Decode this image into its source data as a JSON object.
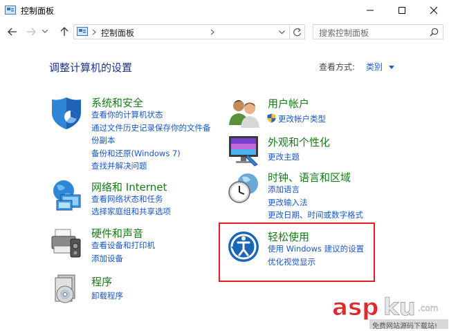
{
  "window": {
    "title": "控制面板",
    "minimize_icon": "minimize-icon",
    "maximize_icon": "maximize-icon",
    "close_icon": "close-icon"
  },
  "nav": {
    "address_path": "控制面板",
    "search_placeholder": "搜索控制面板"
  },
  "main": {
    "heading": "调整计算机的设置",
    "view_by_label": "查看方式:",
    "view_by_value": "类别"
  },
  "categories": {
    "system_security": {
      "title": "系统和安全",
      "links": [
        "查看你的计算机状态",
        "通过文件历史记录保存你的文件备",
        "份副本",
        "备份和还原(Windows 7)",
        "查找并解决问题"
      ]
    },
    "network": {
      "title": "网络和 Internet",
      "links": [
        "查看网络状态和任务",
        "选择家庭组和共享选项"
      ]
    },
    "hardware": {
      "title": "硬件和声音",
      "links": [
        "查看设备和打印机",
        "添加设备"
      ]
    },
    "programs": {
      "title": "程序",
      "links": [
        "卸载程序"
      ]
    },
    "user_accounts": {
      "title": "用户帐户",
      "links": [
        "更改帐户类型"
      ]
    },
    "appearance": {
      "title": "外观和个性化",
      "links": [
        "更改主题"
      ]
    },
    "clock_region": {
      "title": "时钟、语言和区域",
      "links": [
        "添加语言",
        "更改输入法",
        "更改日期、时间或数字格式"
      ]
    },
    "ease_access": {
      "title": "轻松使用",
      "links": [
        "使用 Windows 建议的设置",
        "优化视觉显示"
      ]
    }
  },
  "watermark": {
    "brand": "aspku",
    "brand_suffix": ".com",
    "slogan": "免费网站源码下载站!"
  },
  "colors": {
    "heading": "#1e3287",
    "category_title": "#167a16",
    "link": "#1757c8",
    "highlight": "#e41c1c"
  }
}
